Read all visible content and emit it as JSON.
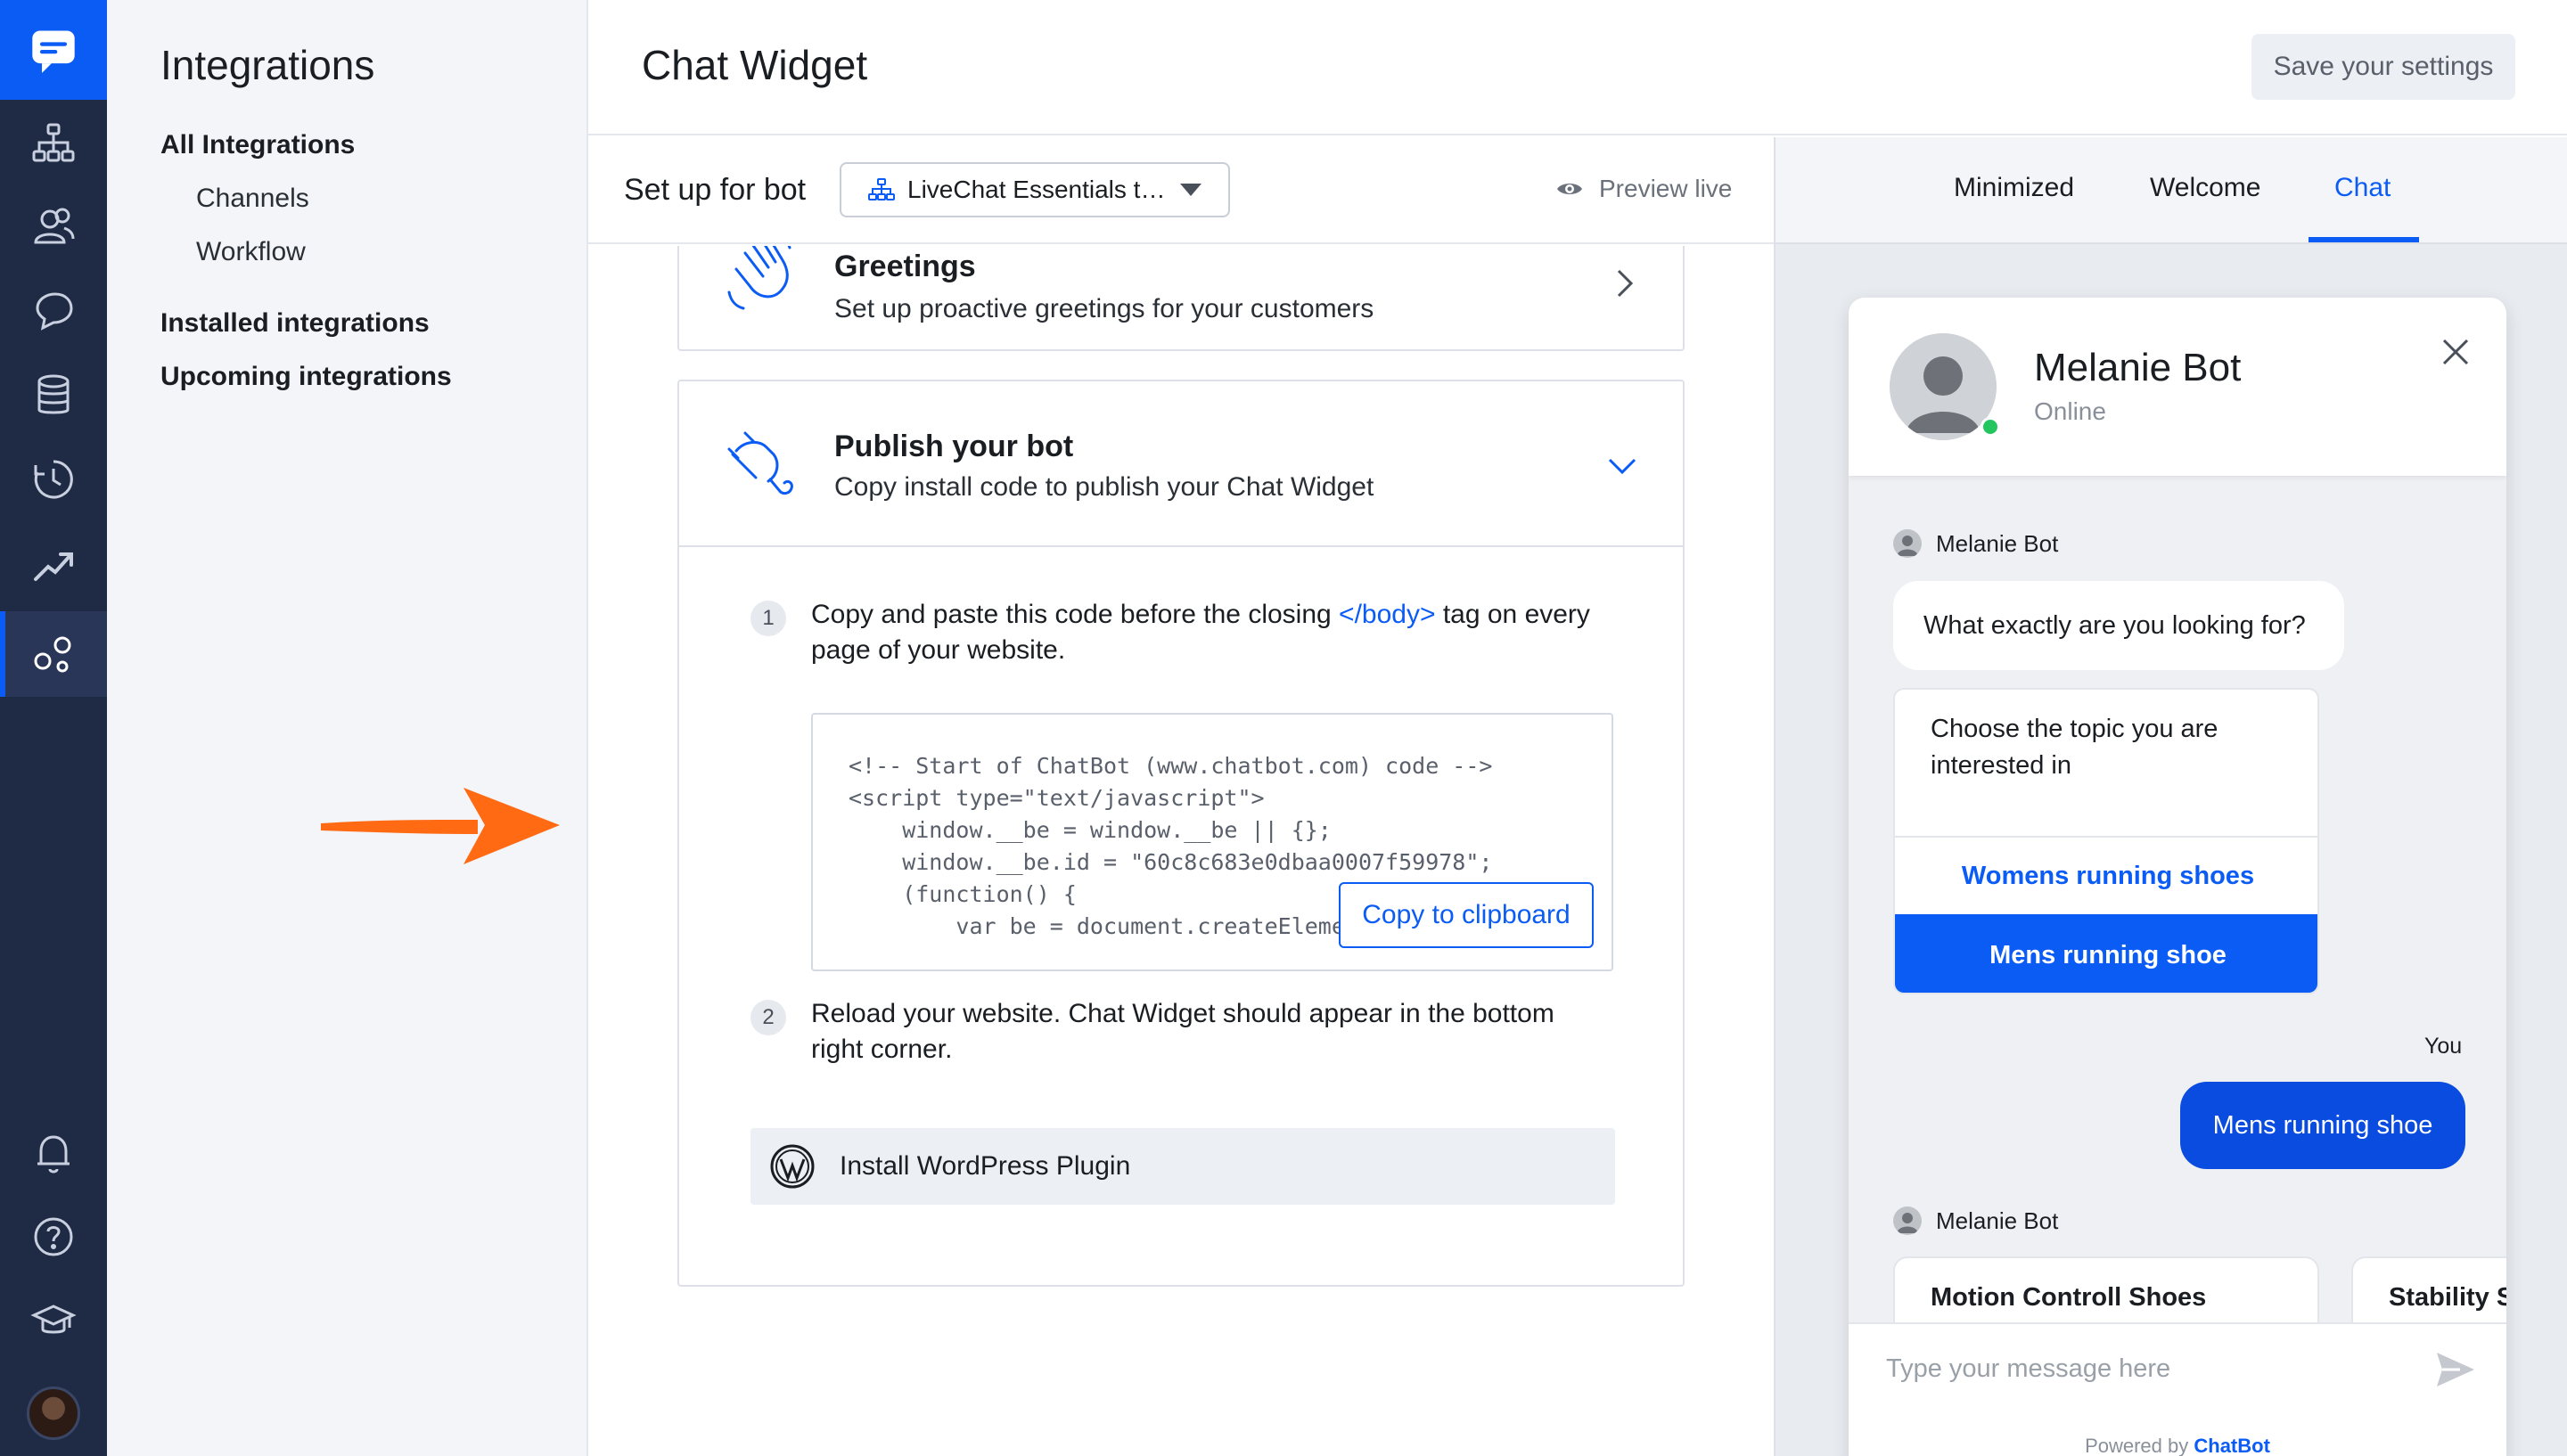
{
  "subnav": {
    "title": "Integrations",
    "items": [
      {
        "label": "All Integrations"
      },
      {
        "label": "Channels"
      },
      {
        "label": "Workflow"
      },
      {
        "label": "Installed integrations"
      },
      {
        "label": "Upcoming integrations"
      }
    ]
  },
  "header": {
    "title": "Chat Widget",
    "save_label": "Save your settings"
  },
  "setup": {
    "label": "Set up for bot",
    "select_value": "LiveChat Essentials t…",
    "preview_label": "Preview live"
  },
  "greetings": {
    "title": "Greetings",
    "subtitle": "Set up proactive greetings for your customers"
  },
  "publish": {
    "title": "Publish your bot",
    "subtitle": "Copy install code to publish your Chat Widget",
    "step1_num": "1",
    "step1_before": "Copy and paste this code before the closing ",
    "step1_tag": "</body>",
    "step1_after": " tag on every page of your website.",
    "code": "<!-- Start of ChatBot (www.chatbot.com) code -->\n<script type=\"text/javascript\">\n    window.__be = window.__be || {};\n    window.__be.id = \"60c8c683e0dbaa0007f59978\";\n    (function() {\n        var be = document.createElement('script');",
    "copy_label": "Copy to clipboard",
    "step2_num": "2",
    "step2_text": "Reload your website. Chat Widget should appear in the bottom right corner.",
    "wp_label": "Install WordPress Plugin"
  },
  "preview_tabs": [
    {
      "label": "Minimized"
    },
    {
      "label": "Welcome"
    },
    {
      "label": "Chat"
    }
  ],
  "widget": {
    "bot_name": "Melanie Bot",
    "status": "Online",
    "sender_name": "Melanie Bot",
    "bot_question": "What exactly are you looking for?",
    "topic_question": "Choose the topic you are interested in",
    "option_1": "Womens running shoes",
    "option_2": "Mens running shoe",
    "you_label": "You",
    "user_message": "Mens running shoe",
    "sender_name_2": "Melanie Bot",
    "product_1": "Motion Controll Shoes",
    "product_2": "Stability Shoes",
    "input_placeholder": "Type your message here",
    "powered_prefix": "Powered by ",
    "powered_brand": "ChatBot"
  },
  "colors": {
    "accent": "#0a5cf5",
    "rail_bg": "#1f2a44",
    "arrow": "#ff6a13",
    "online": "#22c55e"
  }
}
